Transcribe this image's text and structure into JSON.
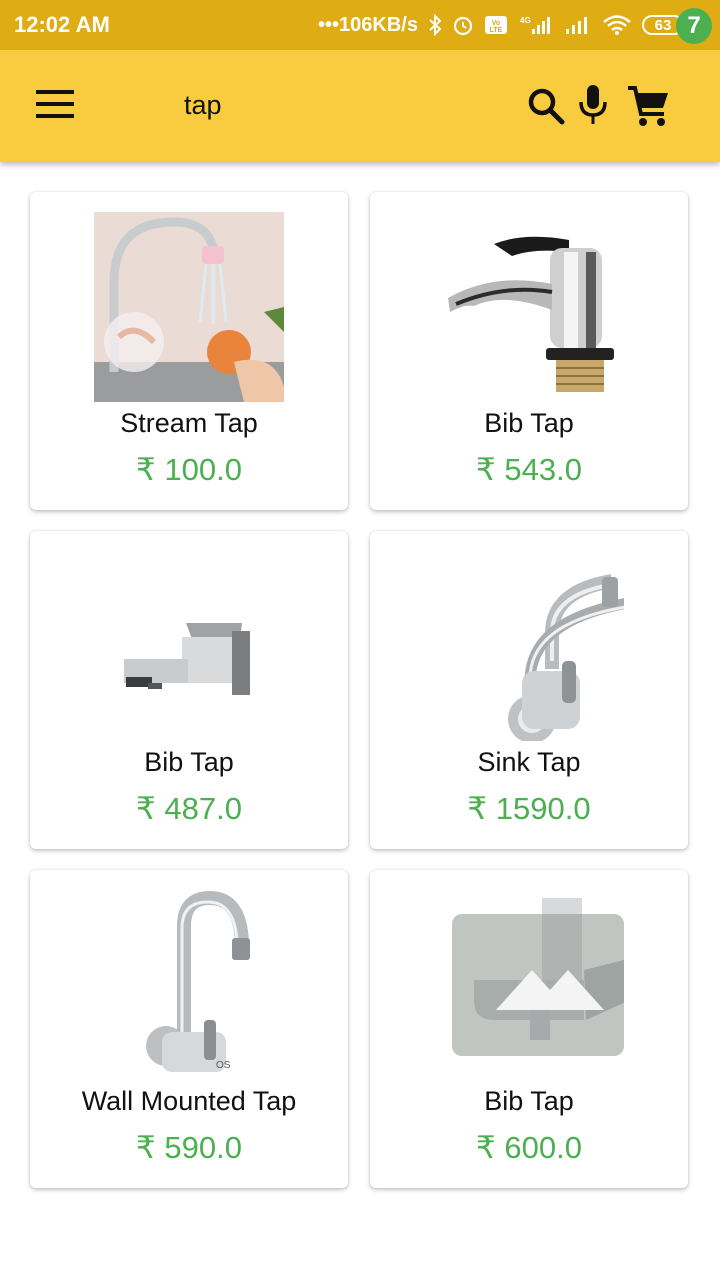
{
  "status_bar": {
    "time": "12:02 AM",
    "network_speed": "•••106KB/s",
    "battery": "63",
    "network_type": "4G"
  },
  "app_bar": {
    "title": "tap",
    "cart_count": "7",
    "background_color": "#F9CC3F"
  },
  "products": [
    {
      "name": "Stream Tap",
      "price": "₹ 100.0",
      "icon": "stream-tap-image"
    },
    {
      "name": "Bib Tap",
      "price": "₹ 543.0",
      "icon": "bib-tap-image"
    },
    {
      "name": "Bib Tap",
      "price": "₹ 487.0",
      "icon": "bib-tap-image"
    },
    {
      "name": "Sink Tap",
      "price": "₹ 1590.0",
      "icon": "sink-tap-image"
    },
    {
      "name": "Wall Mounted Tap",
      "price": "₹ 590.0",
      "icon": "wall-mounted-tap-image"
    },
    {
      "name": "Bib Tap",
      "price": "₹ 600.0",
      "icon": "bib-tap-image"
    }
  ],
  "colors": {
    "status_bar": "#E0AC14",
    "price": "#4CAF50",
    "badge": "#4CAF50"
  }
}
